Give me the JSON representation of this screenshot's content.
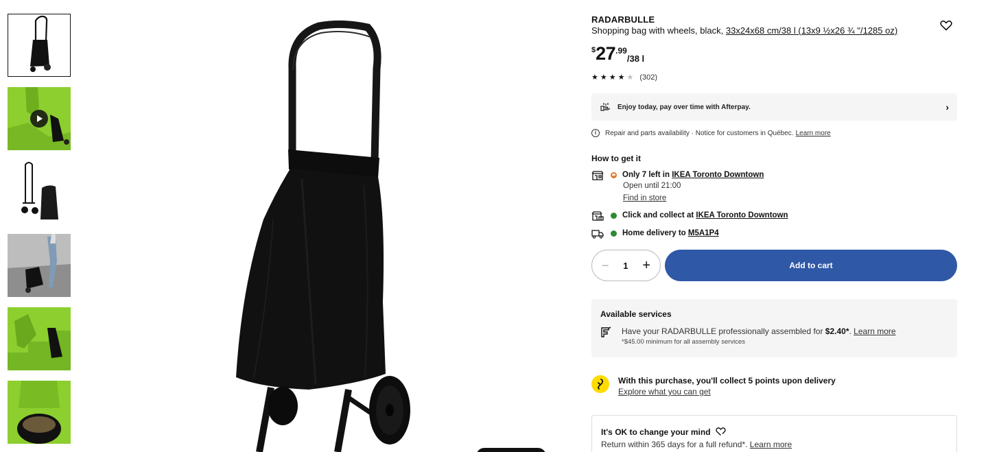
{
  "product": {
    "brand": "RADARBULLE",
    "description": "Shopping bag with wheels, black, ",
    "measurements": "33x24x68 cm/38 l (13x9 ½x26 ¾ \"/1285 oz)",
    "price": {
      "currency": "$",
      "integer": "27",
      "decimal": ".99",
      "unit": "/38 l"
    },
    "rating": {
      "stars": 4.5,
      "count": "(302)"
    }
  },
  "icons": {
    "favorite": "heart-icon",
    "afterpay": "afterpay-hand-icon",
    "info": "info-icon",
    "store": "store-icon",
    "click_collect": "click-collect-icon",
    "delivery": "truck-icon",
    "assembly": "assembly-icon",
    "points": "points-icon",
    "returns": "returns-heart-icon"
  },
  "afterpay": {
    "text": "Enjoy today, pay over time with Afterpay.",
    "chevron": "›"
  },
  "notice": {
    "info_glyph": "i",
    "text": "Repair and parts availability · Notice for customers in Québec.",
    "link": "Learn more"
  },
  "availability": {
    "heading": "How to get it",
    "store": {
      "prefix": "Only 7 left in ",
      "store": "IKEA Toronto Downtown",
      "hours": "Open until 21:00",
      "find": "Find in store"
    },
    "collect": {
      "prefix": "Click and collect at ",
      "store": "IKEA Toronto Downtown"
    },
    "delivery": {
      "prefix": "Home delivery to ",
      "postal": "M5A1P4"
    }
  },
  "cart": {
    "minus": "−",
    "quantity": "1",
    "plus": "+",
    "add_label": "Add to cart"
  },
  "services": {
    "title": "Available services",
    "line_prefix": "Have your RADARBULLE professionally assembled for ",
    "price": "$2.40*",
    "dot": ". ",
    "link": "Learn more",
    "note": "*$45.00 minimum for all assembly services"
  },
  "points": {
    "text": "With this purchase, you'll collect 5 points upon delivery",
    "link": "Explore what you can get"
  },
  "returns": {
    "title": "It's OK to change your mind",
    "text": "Return within 365 days for a full refund*. ",
    "link": "Learn more"
  },
  "colors": {
    "accent": "#2f58a6",
    "green": "#2e8a33",
    "orange": "#e07b2c",
    "points_yellow": "#ffdb00",
    "lime": "#8ccf2e"
  }
}
